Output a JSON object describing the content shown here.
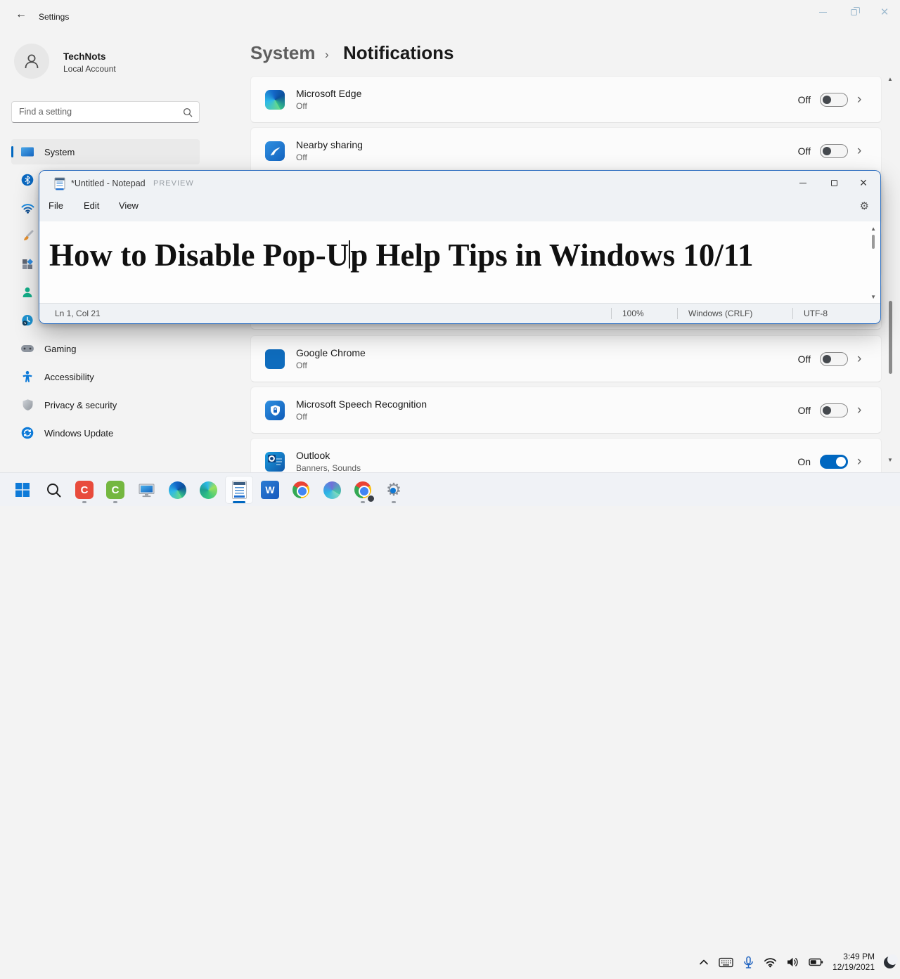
{
  "settings": {
    "title": "Settings",
    "user": {
      "name": "TechNots",
      "account_type": "Local Account"
    },
    "search": {
      "placeholder": "Find a setting"
    },
    "sidebar": {
      "items": [
        {
          "icon": "system-icon",
          "label": "System",
          "selected": true
        },
        {
          "icon": "bluetooth-icon",
          "label": ""
        },
        {
          "icon": "wifi-icon",
          "label": ""
        },
        {
          "icon": "personalization-brush-icon",
          "label": ""
        },
        {
          "icon": "apps-icon",
          "label": ""
        },
        {
          "icon": "accounts-person-icon",
          "label": ""
        },
        {
          "icon": "time-language-clock-icon",
          "label": ""
        },
        {
          "icon": "gaming-controller-icon",
          "label": "Gaming"
        },
        {
          "icon": "accessibility-person-icon",
          "label": "Accessibility"
        },
        {
          "icon": "privacy-shield-icon",
          "label": "Privacy & security"
        },
        {
          "icon": "windows-update-icon",
          "label": "Windows Update"
        }
      ]
    },
    "breadcrumb": {
      "parent": "System",
      "separator": "›",
      "page": "Notifications"
    },
    "rows": [
      {
        "icon": "microsoft-edge-icon",
        "title": "Microsoft Edge",
        "subtitle": "Off",
        "state_label": "Off",
        "enabled": false
      },
      {
        "icon": "nearby-sharing-icon",
        "title": "Nearby sharing",
        "subtitle": "Off",
        "state_label": "Off",
        "enabled": false
      },
      {
        "icon": "google-chrome-icon",
        "title": "Google Chrome",
        "subtitle": "Off",
        "state_label": "Off",
        "enabled": false
      },
      {
        "icon": "speech-recognition-icon",
        "title": "Microsoft Speech Recognition",
        "subtitle": "Off",
        "state_label": "Off",
        "enabled": false
      },
      {
        "icon": "outlook-icon",
        "title": "Outlook",
        "subtitle": "Banners, Sounds",
        "state_label": "On",
        "enabled": true
      }
    ]
  },
  "notepad": {
    "title": "*Untitled - Notepad",
    "badge": "PREVIEW",
    "menu": {
      "file": "File",
      "edit": "Edit",
      "view": "View"
    },
    "content": "How to Disable Pop-Up Help Tips in Windows 10/11",
    "caret_index": 20,
    "status": {
      "cursor": "Ln 1, Col 21",
      "zoom": "100%",
      "eol": "Windows (CRLF)",
      "encoding": "UTF-8"
    }
  },
  "taskbar": {
    "icons": [
      "start",
      "search",
      "camtasia",
      "camtasia-recorder",
      "this-pc",
      "edge",
      "edge-beta",
      "notepad",
      "word",
      "chrome",
      "edge-dev",
      "chrome-profile",
      "settings-gear"
    ],
    "active_icon": "notepad",
    "running_icons": [
      "camtasia",
      "camtasia-recorder",
      "chrome-profile",
      "settings-gear"
    ],
    "clock": {
      "time": "3:49 PM",
      "date": "12/19/2021"
    }
  },
  "colors": {
    "accent": "#0067c0",
    "notepad_border": "#2e6fc0",
    "toggle_on": "#0067c0"
  }
}
